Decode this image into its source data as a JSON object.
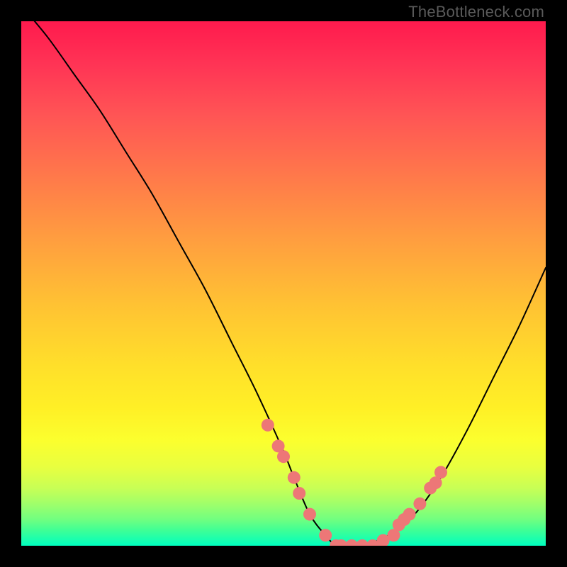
{
  "watermark": "TheBottleneck.com",
  "colors": {
    "frame_bg": "#000000",
    "marker": "#ed7777",
    "curve": "#000000"
  },
  "chart_data": {
    "type": "line",
    "title": "",
    "xlabel": "",
    "ylabel": "",
    "xlim": [
      0,
      100
    ],
    "ylim": [
      0,
      100
    ],
    "series": [
      {
        "name": "bottleneck-curve",
        "x": [
          0,
          5,
          10,
          15,
          20,
          25,
          30,
          35,
          40,
          45,
          50,
          52,
          55,
          58,
          60,
          62,
          65,
          68,
          70,
          75,
          80,
          85,
          90,
          95,
          100
        ],
        "values": [
          103,
          97,
          90,
          83,
          75,
          67,
          58,
          49,
          39,
          29,
          18,
          13,
          6,
          2,
          0,
          0,
          0,
          1,
          2,
          6,
          13,
          22,
          32,
          42,
          53
        ]
      }
    ],
    "markers": {
      "name": "highlighted-points",
      "x": [
        47,
        49,
        50,
        52,
        53,
        55,
        58,
        60,
        61,
        63,
        65,
        67,
        69,
        71,
        72,
        73,
        74,
        76,
        78,
        79,
        80
      ],
      "values": [
        23,
        19,
        17,
        13,
        10,
        6,
        2,
        0,
        0,
        0,
        0,
        0,
        1,
        2,
        4,
        5,
        6,
        8,
        11,
        12,
        14
      ]
    }
  }
}
